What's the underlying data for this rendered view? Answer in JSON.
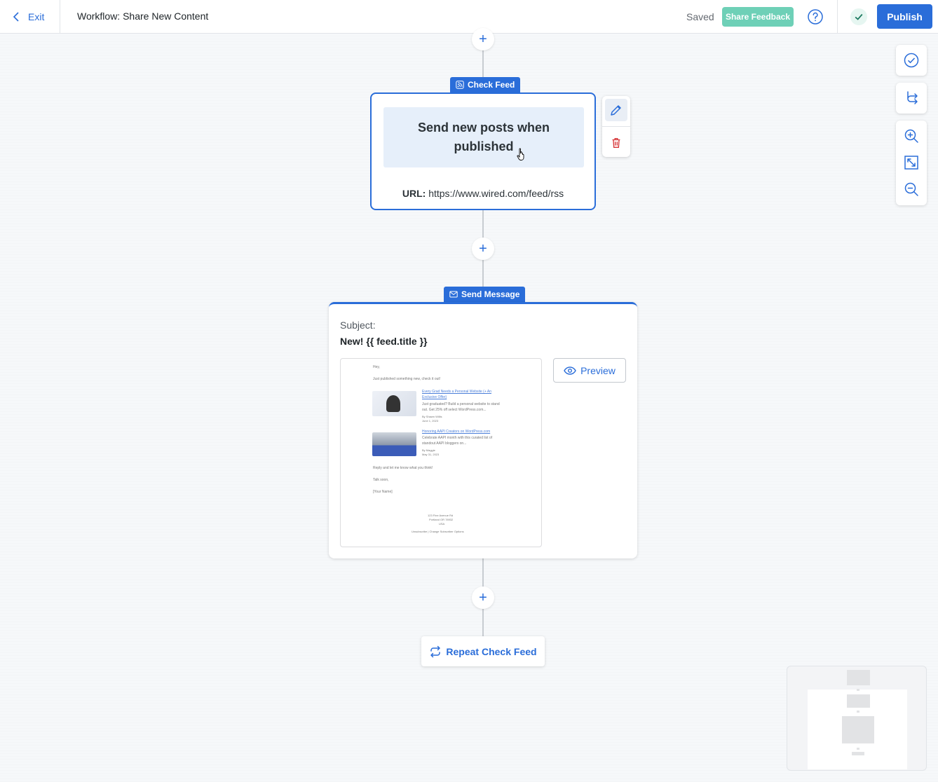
{
  "header": {
    "exit_label": "Exit",
    "title": "Workflow: Share New Content",
    "saved_label": "Saved",
    "share_feedback_label": "Share Feedback",
    "publish_label": "Publish"
  },
  "steps": {
    "check_feed": {
      "label": "Check Feed",
      "description": "Send new posts when published",
      "url_label": "URL:",
      "url": "https://www.wired.com/feed/rss"
    },
    "send_message": {
      "label": "Send Message",
      "subject_label": "Subject:",
      "subject": "New! {{ feed.title }}",
      "preview_label": "Preview",
      "email": {
        "greeting": "Hey,",
        "intro": "Just published something new, check it out!",
        "post1_title": "Every Grad Needs a Personal Website (+ An",
        "post1_title2": "Exclusive Offer)",
        "post1_excerpt": "Just graduated? Build a personal website to stand",
        "post1_excerpt2": "out. Get 25% off select WordPress.com...",
        "post1_author": "By Shawn Willis",
        "post1_date": "June 1, 2023",
        "post2_title": "Honoring AAPI Creators on WordPress.com",
        "post2_excerpt": "Celebrate AAPI month with this curated list of",
        "post2_excerpt2": "standout AAPI bloggers on...",
        "post2_author": "By Maggie",
        "post2_date": "May 31, 2023",
        "reply": "Reply and let me know what you think!",
        "talk": "Talk soon,",
        "sign": "[Your Name]",
        "address1": "123 Fine Avenue Rd",
        "address2": "Portland OR 78932",
        "address3": "USA",
        "footer": "Unsubscribe  |  Change Subscriber Options"
      }
    },
    "repeat_label": "Repeat Check Feed"
  },
  "icons": {
    "back": "chevron-left-icon",
    "help": "help-circle-icon",
    "saved_check": "check-icon",
    "feed": "rss-icon",
    "mail": "mail-icon",
    "edit": "pencil-icon",
    "delete": "trash-icon",
    "preview": "eye-icon",
    "repeat": "repeat-icon",
    "validate": "check-circle-icon",
    "branch": "branch-icon",
    "zoom_in": "zoom-in-icon",
    "fit": "fit-screen-icon",
    "zoom_out": "zoom-out-icon"
  },
  "colors": {
    "accent": "#2a6dd9",
    "feedback": "#6ed0b7",
    "danger": "#d63638"
  }
}
